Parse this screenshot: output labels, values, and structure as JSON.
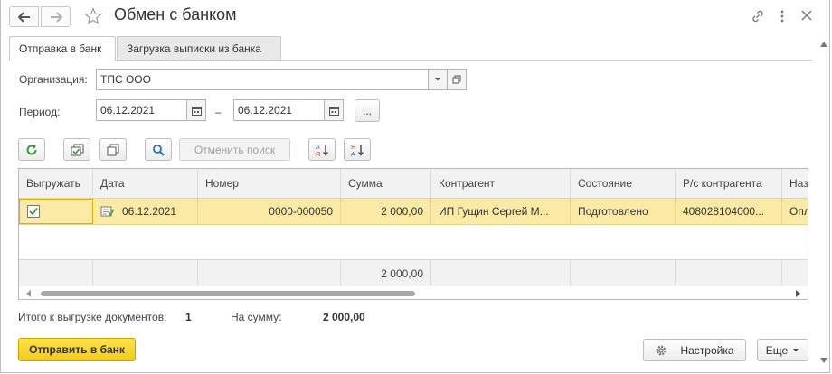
{
  "window": {
    "title": "Обмен с банком"
  },
  "tabs": [
    {
      "label": "Отправка в банк",
      "active": true
    },
    {
      "label": "Загрузка выписки из банка",
      "active": false
    }
  ],
  "form": {
    "org_label": "Организация:",
    "org_value": "ТПС ООО",
    "period_label": "Период:",
    "date_from": "06.12.2021",
    "date_dash": "–",
    "date_to": "06.12.2021",
    "period_more": "..."
  },
  "toolbar": {
    "cancel_search": "Отменить поиск"
  },
  "table": {
    "columns": [
      "Выгружать",
      "Дата",
      "Номер",
      "Сумма",
      "Контрагент",
      "Состояние",
      "Р/с контрагента",
      "Наз"
    ],
    "rows": [
      {
        "checked": true,
        "date": "06.12.2021",
        "number": "0000-000050",
        "sum": "2 000,00",
        "counterparty": "ИП Гущин Сергей М...",
        "state": "Подготовлено",
        "account": "408028104000...",
        "purpose": "Опл"
      }
    ],
    "footer_sum": "2 000,00"
  },
  "summary": {
    "docs_label": "Итого к выгрузке документов:",
    "docs_count": "1",
    "sum_label": "На сумму:",
    "sum_value": "2 000,00"
  },
  "actions": {
    "send": "Отправить в банк",
    "settings": "Настройка",
    "more": "Еще"
  },
  "colors": {
    "accent_yellow": "#f2c91b",
    "selected_row": "#fbeaa5",
    "green_icon": "#3a9b3a",
    "blue_icon": "#2a6bbf",
    "red_icon": "#c0392b"
  }
}
